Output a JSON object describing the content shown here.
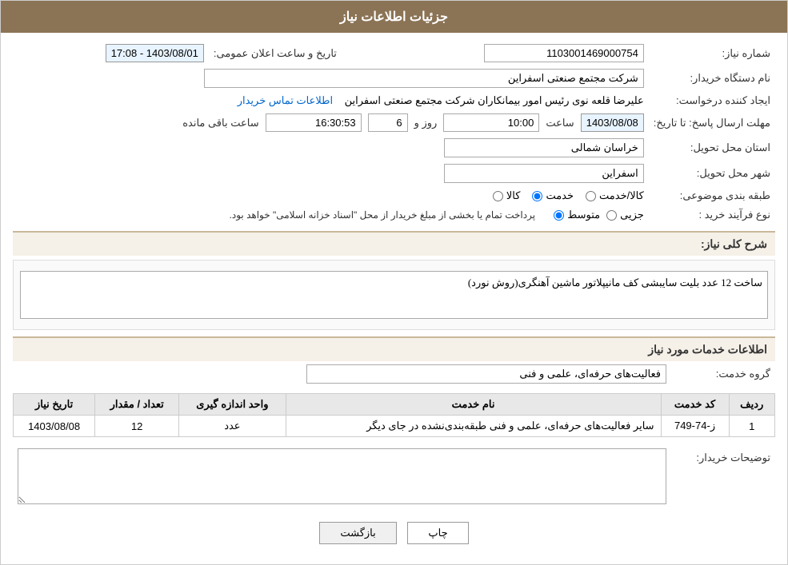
{
  "header": {
    "title": "جزئیات اطلاعات نیاز"
  },
  "fields": {
    "need_number_label": "شماره نیاز:",
    "need_number_value": "1103001469000754",
    "buyer_org_label": "نام دستگاه خریدار:",
    "buyer_org_value": "شرکت مجتمع صنعتی اسفراین",
    "creator_label": "ایجاد کننده درخواست:",
    "creator_value": "علیرضا قلعه نوی رئیس امور بیمانکاران شرکت مجتمع صنعتی اسفراین",
    "creator_link": "اطلاعات تماس خریدار",
    "response_deadline_label": "مهلت ارسال پاسخ: تا تاریخ:",
    "announce_date_label": "تاریخ و ساعت اعلان عمومی:",
    "announce_date_value": "1403/08/01 - 17:08",
    "response_date": "1403/08/08",
    "response_time": "10:00",
    "response_days": "6",
    "response_clock": "16:30:53",
    "province_label": "استان محل تحویل:",
    "province_value": "خراسان شمالی",
    "city_label": "شهر محل تحویل:",
    "city_value": "اسفراین",
    "category_label": "طبقه بندی موضوعی:",
    "category_kala": "کالا",
    "category_khadamat": "خدمت",
    "category_kala_khadamat": "کالا/خدمت",
    "category_selected": "khadamat",
    "purchase_type_label": "نوع فرآیند خرید :",
    "purchase_jozei": "جزیی",
    "purchase_motavaset": "متوسط",
    "purchase_note": "پرداخت تمام یا بخشی از مبلغ خریدار از محل \"اسناد خزانه اسلامی\" خواهد بود.",
    "description_label": "شرح کلی نیاز:",
    "description_value": "ساخت 12 عدد بلیت سایبشی کف مانیپلاتور ماشین آهنگری(روش نورد)",
    "services_section_label": "اطلاعات خدمات مورد نیاز",
    "service_group_label": "گروه خدمت:",
    "service_group_value": "فعالیت‌های حرفه‌ای، علمی و فنی",
    "table_headers": [
      "ردیف",
      "کد خدمت",
      "نام خدمت",
      "واحد اندازه گیری",
      "تعداد / مقدار",
      "تاریخ نیاز"
    ],
    "table_rows": [
      {
        "row_num": "1",
        "service_code": "ز-74-749",
        "service_name": "سایر فعالیت‌های حرفه‌ای، علمی و فنی طبقه‌بندی‌نشده در جای دیگر",
        "unit": "عدد",
        "quantity": "12",
        "date": "1403/08/08"
      }
    ],
    "buyer_comments_label": "توضیحات خریدار:",
    "buyer_comments_value": ""
  },
  "buttons": {
    "print_label": "چاپ",
    "back_label": "بازگشت"
  }
}
